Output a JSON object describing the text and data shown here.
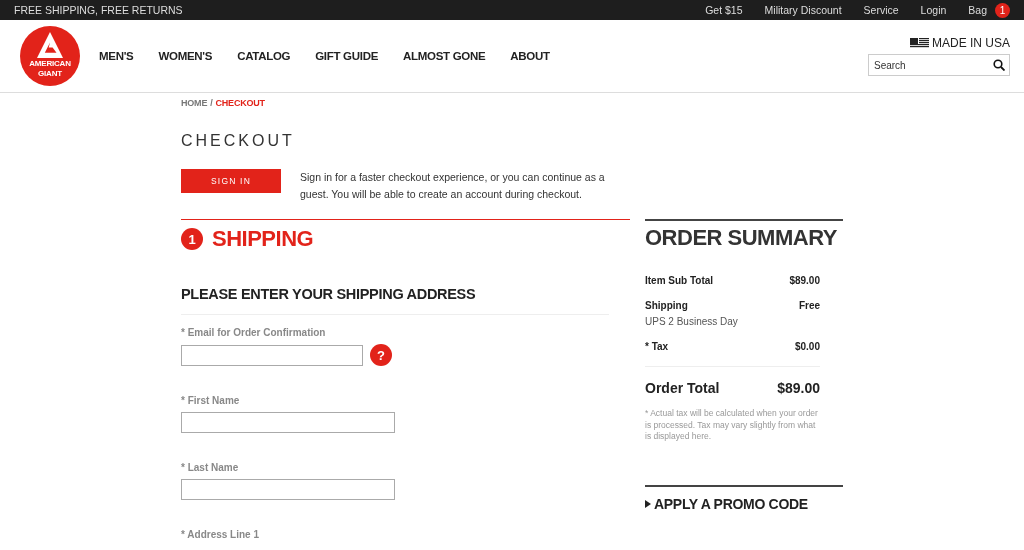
{
  "top_bar": {
    "promo": "FREE SHIPPING, FREE RETURNS",
    "links": [
      "Get $15",
      "Military Discount",
      "Service",
      "Login",
      "Bag"
    ],
    "bag_count": "1"
  },
  "header": {
    "logo": {
      "line_1": "AMERICAN",
      "line_2": "GIANT"
    },
    "nav": [
      "MEN'S",
      "WOMEN'S",
      "CATALOG",
      "GIFT GUIDE",
      "ALMOST GONE",
      "ABOUT"
    ],
    "made_in": "MADE IN USA",
    "search": {
      "placeholder": "Search"
    }
  },
  "breadcrumb": [
    {
      "label": "HOME",
      "current": false
    },
    {
      "label": "CHECKOUT",
      "current": true
    }
  ],
  "breadcrumb_separator": "/",
  "page_title": "CHECKOUT",
  "sign_in": {
    "button": "SIGN IN",
    "text": "Sign in for a faster checkout experience, or you can continue as a guest. You will be able to create an account during checkout."
  },
  "shipping": {
    "step": "1",
    "title": "SHIPPING",
    "subtitle": "PLEASE ENTER YOUR SHIPPING ADDRESS",
    "fields": [
      {
        "label": "* Email for Order Confirmation",
        "kind": "email",
        "help": "?"
      },
      {
        "label": "* First Name",
        "kind": "text"
      },
      {
        "label": "* Last Name",
        "kind": "text"
      },
      {
        "label": "* Address Line 1",
        "kind": "label_only"
      }
    ]
  },
  "order_summary": {
    "title": "ORDER SUMMARY",
    "rows": [
      {
        "label": "Item Sub Total",
        "value": "$89.00"
      },
      {
        "label": "Shipping",
        "value": "Free",
        "detail": "UPS 2 Business Day"
      },
      {
        "label": "* Tax",
        "value": "$0.00"
      }
    ],
    "total_label": "Order Total",
    "total_value": "$89.00",
    "note": "* Actual tax will be calculated when your order is processed. Tax may vary slightly from what is displayed here.",
    "promo": "APPLY A PROMO CODE"
  }
}
